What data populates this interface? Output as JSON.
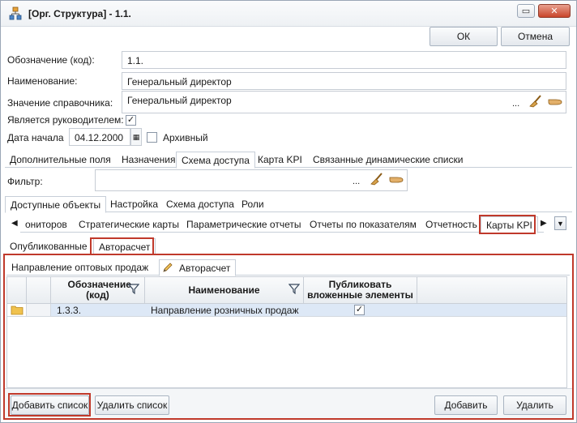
{
  "window": {
    "title": "[Орг. Структура] - 1.1.",
    "ok_label": "ОК",
    "cancel_label": "Отмена"
  },
  "form": {
    "code_label": "Обозначение (код):",
    "code_value": "1.1.",
    "name_label": "Наименование:",
    "name_value": "Генеральный директор",
    "ref_label": "Значение справочника:",
    "ref_value": "Генеральный директор",
    "ref_dots": "...",
    "is_manager_label": "Является руководителем:",
    "is_manager_checked": "✓",
    "start_date_label": "Дата начала",
    "start_date_value": "04.12.2000",
    "archive_label": "Архивный"
  },
  "main_tabs": [
    {
      "label": "Дополнительные поля"
    },
    {
      "label": "Назначения"
    },
    {
      "label": "Схема доступа"
    },
    {
      "label": "Карта KPI"
    },
    {
      "label": "Связанные динамические списки"
    }
  ],
  "filter": {
    "label": "Фильтр:",
    "dots": "..."
  },
  "sub_tabs": [
    {
      "label": "Доступные объекты"
    },
    {
      "label": "Настройка"
    },
    {
      "label": "Схема доступа"
    },
    {
      "label": "Роли"
    }
  ],
  "object_tabs": [
    {
      "label": "ониторов"
    },
    {
      "label": "Стратегические карты"
    },
    {
      "label": "Параметрические отчеты"
    },
    {
      "label": "Отчеты по показателям"
    },
    {
      "label": "Отчетность"
    },
    {
      "label": "Карты KPI"
    }
  ],
  "kpi_tabs": [
    {
      "label": "Опубликованные"
    },
    {
      "label": "Авторасчет"
    }
  ],
  "inner_tabs": [
    {
      "label": "Направление оптовых продаж"
    },
    {
      "label": "Авторасчет"
    }
  ],
  "grid": {
    "col_code": "Обозначение (код)",
    "col_name": "Наименование",
    "col_publish": "Публиковать вложенные элементы",
    "rows": [
      {
        "code": "1.3.3.",
        "name": "Направление розничных продаж",
        "publish": "✓"
      }
    ]
  },
  "footer": {
    "add_list": "Добавить список",
    "remove_list": "Удалить список",
    "add": "Добавить",
    "remove": "Удалить"
  },
  "colors": {
    "highlight": "#c0392b",
    "selected_row": "#dde8f6",
    "folder": "#f0c24e"
  }
}
